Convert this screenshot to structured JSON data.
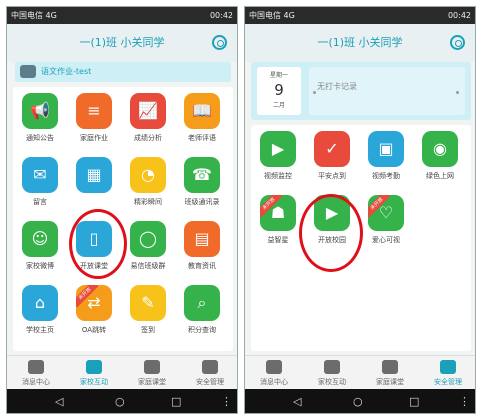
{
  "status": {
    "carrier": "中国电信 4G",
    "time": "00:42"
  },
  "left": {
    "title": "一(1)班  小关同学",
    "homework": "语文作业-test",
    "apps": [
      {
        "label": "通知公告",
        "color": "#36b24a",
        "glyph": "📢",
        "icon": "megaphone-icon"
      },
      {
        "label": "家庭作业",
        "color": "#f06a2a",
        "glyph": "≡",
        "icon": "homework-icon"
      },
      {
        "label": "成绩分析",
        "color": "#e84b3c",
        "glyph": "📈",
        "icon": "chart-icon"
      },
      {
        "label": "老师评语",
        "color": "#f59c1a",
        "glyph": "📖",
        "icon": "book-icon"
      },
      {
        "label": "留言",
        "color": "#2aa6d8",
        "glyph": "✉",
        "icon": "envelope-icon"
      },
      {
        "label": "",
        "color": "#2aa6d8",
        "glyph": "▦",
        "icon": "grid-icon"
      },
      {
        "label": "精彩瞬间",
        "color": "#f7c21a",
        "glyph": "◔",
        "icon": "moment-icon"
      },
      {
        "label": "班级通讯录",
        "color": "#36b24a",
        "glyph": "☎",
        "icon": "contacts-icon"
      },
      {
        "label": "家校微博",
        "color": "#36b24a",
        "glyph": "☺",
        "icon": "weibo-icon"
      },
      {
        "label": "开放课堂",
        "color": "#2aa6d8",
        "glyph": "▯",
        "icon": "open-class-icon"
      },
      {
        "label": "易信班级群",
        "color": "#36b24a",
        "glyph": "◯",
        "icon": "group-chat-icon"
      },
      {
        "label": "教育资讯",
        "color": "#f06a2a",
        "glyph": "▤",
        "icon": "news-icon"
      },
      {
        "label": "学校主页",
        "color": "#2aa6d8",
        "glyph": "⌂",
        "icon": "school-icon"
      },
      {
        "label": "OA跳转",
        "color": "#f59c1a",
        "glyph": "⇄",
        "icon": "oa-icon"
      },
      {
        "label": "签到",
        "color": "#f7c21a",
        "glyph": "✎",
        "icon": "sign-in-icon"
      },
      {
        "label": "积分查询",
        "color": "#36b24a",
        "glyph": "⌕",
        "icon": "points-search-icon"
      }
    ],
    "tabs": [
      "消息中心",
      "家校互动",
      "家庭课堂",
      "安全管理"
    ],
    "ribbon": "未开放"
  },
  "right": {
    "title": "一(1)班  小关同学",
    "attendance": {
      "weekday": "星期一",
      "day": "9",
      "month": "二月",
      "record": "无打卡记录"
    },
    "apps": [
      {
        "label": "视频监控",
        "color": "#36b24a",
        "glyph": "▶",
        "icon": "video-monitor-icon"
      },
      {
        "label": "平安点到",
        "color": "#e84b3c",
        "glyph": "✓",
        "icon": "safety-check-icon"
      },
      {
        "label": "视频考勤",
        "color": "#2aa6d8",
        "glyph": "▣",
        "icon": "video-attendance-icon"
      },
      {
        "label": "绿色上网",
        "color": "#36b24a",
        "glyph": "◉",
        "icon": "green-internet-icon"
      },
      {
        "label": "益智星",
        "color": "#36b24a",
        "glyph": "☗",
        "icon": "puzzle-star-icon"
      },
      {
        "label": "开放校园",
        "color": "#36b24a",
        "glyph": "▶",
        "icon": "open-campus-icon"
      },
      {
        "label": "爱心可视",
        "color": "#36b24a",
        "glyph": "♡",
        "icon": "love-visual-icon"
      }
    ],
    "tabs": [
      "消息中心",
      "家校互动",
      "家庭课堂",
      "安全管理"
    ],
    "ribbon": "未开放"
  },
  "nav": {
    "back": "◁",
    "home": "○",
    "recent": "□",
    "menu": "⋮"
  }
}
